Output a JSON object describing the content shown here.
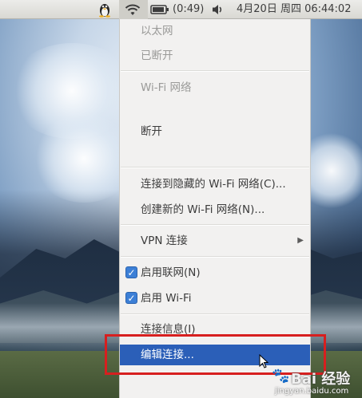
{
  "panel": {
    "battery_time": "(0:49)",
    "datetime": "4月20日 周四 06:44:02",
    "icons": [
      "linux-penguin-icon",
      "wifi-icon",
      "battery-icon",
      "volume-icon"
    ]
  },
  "menu": {
    "ethernet_header": "以太网",
    "ethernet_status": "已断开",
    "wifi_header": "Wi-Fi 网络",
    "disconnect": "断开",
    "connect_hidden": "连接到隐藏的 Wi-Fi 网络(C)...",
    "create_new": "创建新的 Wi-Fi 网络(N)...",
    "vpn": "VPN 连接",
    "enable_networking": "启用联网(N)",
    "enable_wifi": "启用 Wi-Fi",
    "connection_info": "连接信息(I)",
    "edit_connections": "编辑连接..."
  },
  "colors": {
    "highlight": "#2b5fb8",
    "annotation_box": "#d71f1f",
    "checkbox": "#3c7fd6"
  },
  "watermark": {
    "brand": "Bai 经验",
    "url": "jingyan.baidu.com"
  }
}
